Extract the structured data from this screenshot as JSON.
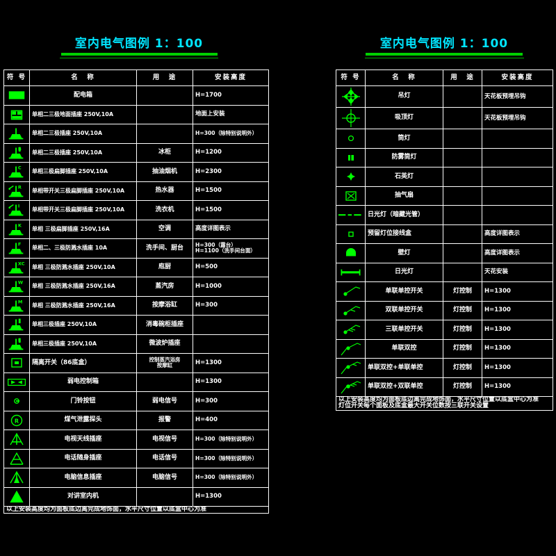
{
  "colors": {
    "background": "#000000",
    "title": "#00e5ff",
    "rule": "#00d000",
    "symbol": "#00ff00",
    "grid": "#ffffff",
    "text": "#ffffff"
  },
  "left": {
    "title": "室内电气图例 1：100",
    "headers": [
      "符 号",
      "名　称",
      "用　途",
      "安装高度"
    ],
    "rows": [
      {
        "icon": "distribution-box",
        "name": "配电箱",
        "use": "",
        "height": "H=1700"
      },
      {
        "icon": "floor-socket-2-3pole",
        "name": "单相二三极地面插座  250V,10A",
        "use": "",
        "height": "地面上安装"
      },
      {
        "icon": "socket-2-3pole",
        "name": "单相二三极插座     250V,10A",
        "use": "",
        "height": "H=300（除特别说明外）"
      },
      {
        "icon": "socket-2-3pole-b",
        "name": "单相二三极插座     250V,10A",
        "use": "冰柜",
        "height": "H=1200"
      },
      {
        "icon": "socket-3pole-flat-c",
        "name": "单相三极扁脚插座   250V,10A",
        "use": "抽油烟机",
        "height": "H=2300"
      },
      {
        "icon": "socket-sw-3pole-r",
        "name": "单相带开关三极扁脚插座 250V,10A",
        "use": "热水器",
        "height": "H=1500"
      },
      {
        "icon": "socket-sw-3pole-i",
        "name": "单相带开关三极扁脚插座 250V,10A",
        "use": "洗衣机",
        "height": "H=1500"
      },
      {
        "icon": "socket-3pole-flat-k",
        "name": "单相 三极扁脚插座 250V,16A",
        "use": "空调",
        "height": "高度详图表示"
      },
      {
        "icon": "socket-waterproof-f",
        "name": "单相二、三极防溅水插座 10A",
        "use": "洗手间、厨台",
        "height": "H=300（露台）\nH=1100（洗手间台面）"
      },
      {
        "icon": "socket-waterproof-xc",
        "name": "单相 三极防溅水插座 250V,10A",
        "use": "庖厨",
        "height": "H=500"
      },
      {
        "icon": "socket-waterproof-w",
        "name": "单相 三极防溅水插座 250V,16A",
        "use": "蒸汽房",
        "height": "H=1000"
      },
      {
        "icon": "socket-waterproof-m",
        "name": "单相 三极防溅水插座 250V,16A",
        "use": "按摩浴缸",
        "height": "H=300"
      },
      {
        "icon": "socket-3pole-t",
        "name": "单相三极插座 250V,10A",
        "use": "消毒碗柜插座",
        "height": ""
      },
      {
        "icon": "socket-3pole-e",
        "name": "单相三极插座 250V,10A",
        "use": "微波炉插座",
        "height": ""
      },
      {
        "icon": "isolating-switch",
        "name": "隔离开关（86底盒）",
        "use": "控制蒸汽浴房\n按摩缸",
        "height": "H=1300"
      },
      {
        "icon": "weak-current-box",
        "name": "弱电控制箱",
        "use": "",
        "height": "H=1300"
      },
      {
        "icon": "doorbell-button",
        "name": "门铃按钮",
        "use": "弱电信号",
        "height": "H=300"
      },
      {
        "icon": "gas-leak-detector",
        "name": "煤气泄露探头",
        "use": "报警",
        "height": "H=400"
      },
      {
        "icon": "tv-antenna-socket",
        "name": "电视天线插座",
        "use": "电视信号",
        "height": "H=300（除特别说明外）"
      },
      {
        "icon": "telephone-socket",
        "name": "电话随身插座",
        "use": "电话信号",
        "height": "H=300（除特别说明外）"
      },
      {
        "icon": "computer-data-socket",
        "name": "电脑信息插座",
        "use": "电脑信号",
        "height": "H=300（除特别说明外）"
      },
      {
        "icon": "intercom-indoor-unit",
        "name": "对讲室内机",
        "use": "",
        "height": "H=1300"
      }
    ],
    "note": "以上安装高度均为面板底边离完成地饰面，水平尺寸位置以底盒中心为准"
  },
  "right": {
    "title": "室内电气图例 1：100",
    "headers": [
      "符 号",
      "名　称",
      "用　途",
      "安装高度"
    ],
    "rows": [
      {
        "icon": "pendant-lamp",
        "name": "吊灯",
        "use": "",
        "height": "天花板预埋吊钩"
      },
      {
        "icon": "ceiling-lamp",
        "name": "吸顶灯",
        "use": "",
        "height": "天花板预埋吊钩"
      },
      {
        "icon": "downlight",
        "name": "筒灯",
        "use": "",
        "height": ""
      },
      {
        "icon": "anti-fog-downlight",
        "name": "防雾筒灯",
        "use": "",
        "height": ""
      },
      {
        "icon": "quartz-lamp",
        "name": "石英灯",
        "use": "",
        "height": ""
      },
      {
        "icon": "exhaust-fan",
        "name": "抽气扇",
        "use": "",
        "height": ""
      },
      {
        "icon": "concealed-fluorescent",
        "name": "日光灯（暗藏光管）",
        "use": "",
        "height": ""
      },
      {
        "icon": "reserved-lamp-junction-box",
        "name": "预留灯位接线盒",
        "use": "",
        "height": "高度详图表示"
      },
      {
        "icon": "wall-lamp",
        "name": "壁灯",
        "use": "",
        "height": "高度详图表示"
      },
      {
        "icon": "fluorescent-lamp",
        "name": "日光灯",
        "use": "",
        "height": "天花安装"
      },
      {
        "icon": "switch-1gang-1way",
        "name": "单联单控开关",
        "use": "灯控制",
        "height": "H=1300"
      },
      {
        "icon": "switch-2gang-1way",
        "name": "双联单控开关",
        "use": "灯控制",
        "height": "H=1300"
      },
      {
        "icon": "switch-3gang-1way",
        "name": "三联单控开关",
        "use": "灯控制",
        "height": "H=1300"
      },
      {
        "icon": "switch-1gang-2way",
        "name": "单联双控",
        "use": "灯控制",
        "height": "H=1300"
      },
      {
        "icon": "switch-1gang-2way-plus-1gang-1way",
        "name": "单联双控+单联单控",
        "use": "灯控制",
        "height": "H=1300"
      },
      {
        "icon": "switch-1gang-2way-plus-2gang-1way",
        "name": "单联双控+双联单控",
        "use": "灯控制",
        "height": "H=1300"
      }
    ],
    "note": "以上安装高度均为面板底边离完成地饰面，水平尺寸位置以底盒中心为准\n灯位开关每个面板及底盒最大开关位数按三联开关设置"
  }
}
